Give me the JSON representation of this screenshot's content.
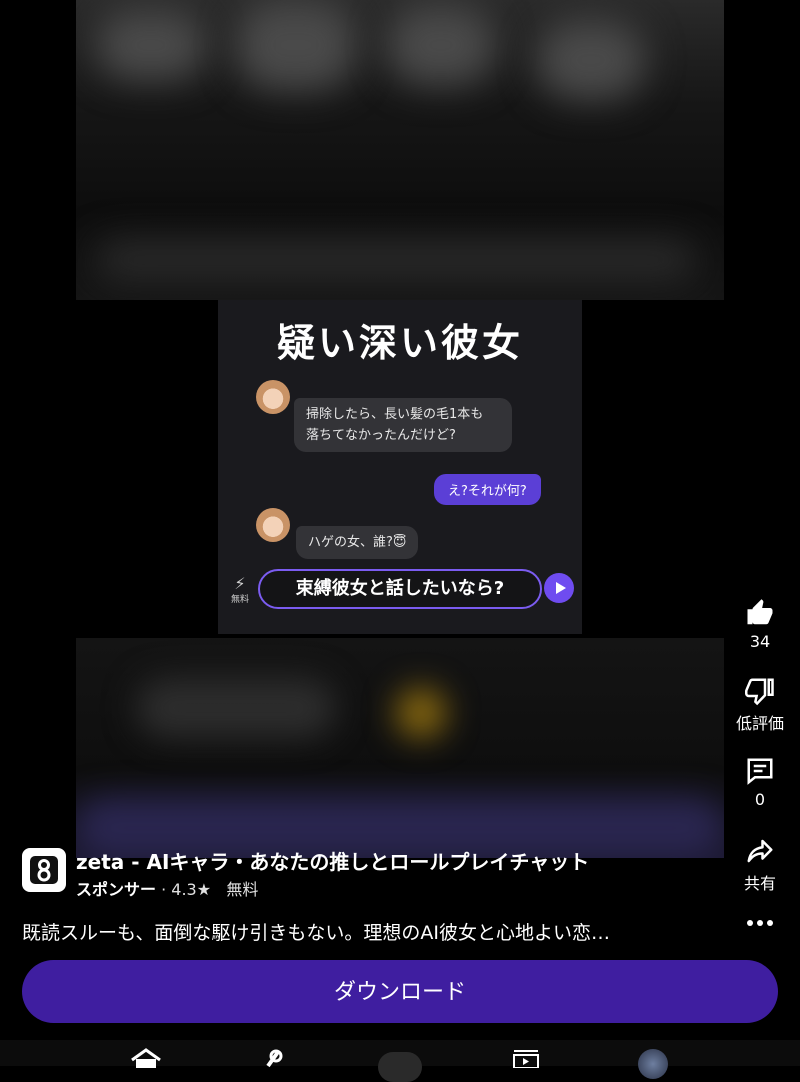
{
  "creative": {
    "headline": "疑い深い彼女",
    "messages": [
      {
        "side": "left",
        "text": "掃除したら、長い髪の毛1本も\n落ちてなかったんだけど?"
      },
      {
        "side": "right",
        "text": "え?それが何?"
      },
      {
        "side": "left",
        "text": "ハゲの女、誰?😇"
      }
    ],
    "free_label": "無料",
    "cta_text": "束縛彼女と話したいなら?"
  },
  "actions": {
    "like_count": "34",
    "dislike_label": "低評価",
    "comment_count": "0",
    "share_label": "共有"
  },
  "ad": {
    "title": "zeta - AIキャラ・あなたの推しとロールプレイチャット",
    "sponsor_label": "スポンサー",
    "rating": " · 4.3★",
    "price": "無料",
    "description": "既読スルーも、面倒な駆け引きもない。理想のAI彼女と心地よい恋…",
    "download_label": "ダウンロード"
  },
  "colors": {
    "download_button": "#3f1ea0",
    "chat_accent": "#5b3fd6"
  },
  "icons": [
    "thumbs-up-icon",
    "thumbs-down-icon",
    "comment-icon",
    "share-icon",
    "more-icon",
    "home-icon",
    "shorts-icon",
    "subscriptions-icon"
  ]
}
